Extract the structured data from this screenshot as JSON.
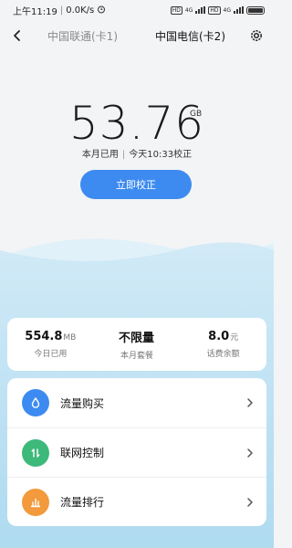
{
  "status_bar": {
    "time": "上午11:19",
    "speed": "0.0K/s",
    "hd1": "HD",
    "net1": "4G",
    "hd2": "HD",
    "net2": "4G"
  },
  "header": {
    "tab_sim1": "中国联通(卡1)",
    "tab_sim2": "中国电信(卡2)"
  },
  "usage": {
    "value": "53.76",
    "unit": "GB",
    "used_label": "本月已用",
    "calibrated_label": "今天10:33校正",
    "calibrate_button": "立即校正"
  },
  "stats": [
    {
      "value": "554.8",
      "unit": "MB",
      "label": "今日已用"
    },
    {
      "value": "不限量",
      "unit": "",
      "label": "本月套餐"
    },
    {
      "value": "8.0",
      "unit": "元",
      "label": "话费余额"
    }
  ],
  "menu": [
    {
      "label": "流量购买",
      "icon": "water-drop-icon",
      "color": "#3d8bf0"
    },
    {
      "label": "联网控制",
      "icon": "up-down-arrows-icon",
      "color": "#3db97a"
    },
    {
      "label": "流量排行",
      "icon": "bar-chart-icon",
      "color": "#f29a3c"
    }
  ],
  "colors": {
    "accent": "#3d8bf0",
    "wave": "#bfe1f2"
  }
}
